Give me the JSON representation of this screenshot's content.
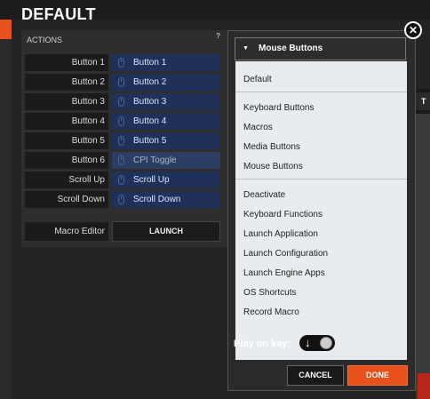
{
  "window": {
    "title": "DEFAULT"
  },
  "actions": {
    "header": "ACTIONS",
    "help": "?",
    "rows": [
      {
        "label": "Button 1",
        "value": "Button 1"
      },
      {
        "label": "Button 2",
        "value": "Button 2"
      },
      {
        "label": "Button 3",
        "value": "Button 3"
      },
      {
        "label": "Button 4",
        "value": "Button 4"
      },
      {
        "label": "Button 5",
        "value": "Button 5"
      },
      {
        "label": "Button 6",
        "value": "CPI Toggle"
      },
      {
        "label": "Scroll Up",
        "value": "Scroll Up"
      },
      {
        "label": "Scroll Down",
        "value": "Scroll Down"
      }
    ],
    "macro_label": "Macro Editor",
    "launch_label": "LAUNCH"
  },
  "dropdown": {
    "selected": "Mouse Buttons",
    "group1": [
      "Default"
    ],
    "group2": [
      "Keyboard Buttons",
      "Macros",
      "Media Buttons",
      "Mouse Buttons"
    ],
    "group3": [
      "Deactivate",
      "Keyboard Functions",
      "Launch Application",
      "Launch Configuration",
      "Launch Engine Apps",
      "OS Shortcuts",
      "Record Macro"
    ],
    "play_on_key_label": "Play on key:",
    "cancel_label": "CANCEL",
    "done_label": "DONE"
  },
  "right_tab": "T",
  "colors": {
    "accent": "#e8501c",
    "binding_bg": "#1f3158",
    "menu_bg": "#e8ecee"
  }
}
